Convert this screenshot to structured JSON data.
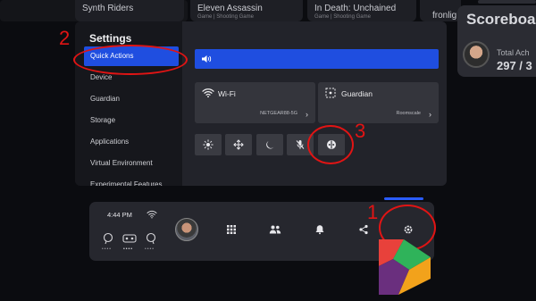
{
  "background": {
    "tiles": [
      {
        "title": "Synth Riders",
        "subtitle": ""
      },
      {
        "title": "Eleven Assassin",
        "subtitle": "Game | Shooting Game"
      },
      {
        "title": "In Death: Unchained",
        "subtitle": "Game | Shooting Game"
      },
      {
        "title": "fronlig",
        "subtitle": ""
      }
    ],
    "scoreboard": {
      "title": "Scoreboa",
      "label": "Total Ach",
      "value": "297 / 3"
    }
  },
  "settings": {
    "title": "Settings",
    "sidebar_items": [
      {
        "label": "Quick Actions",
        "active": true
      },
      {
        "label": "Device"
      },
      {
        "label": "Guardian"
      },
      {
        "label": "Storage"
      },
      {
        "label": "Applications"
      },
      {
        "label": "Virtual Environment"
      },
      {
        "label": "Experimental Features"
      }
    ],
    "volume_icon": "speaker-icon",
    "wifi_card": {
      "label": "Wi-Fi",
      "value": "NETGEAR88-5G",
      "icon": "wifi-icon"
    },
    "guardian_card": {
      "label": "Guardian",
      "value": "Roomscale",
      "icon": "guardian-icon"
    },
    "quick_buttons": [
      "brightness-icon",
      "move-icon",
      "night-mode-icon",
      "mic-off-icon",
      "passthrough-icon"
    ]
  },
  "dock": {
    "time": "4:44 PM",
    "left_status_dots": [
      "••••",
      "••••",
      "••••"
    ],
    "icons": [
      "apps-icon",
      "people-icon",
      "notifications-icon",
      "share-icon",
      "settings-icon"
    ]
  },
  "annotations": [
    {
      "number": "1"
    },
    {
      "number": "2"
    },
    {
      "number": "3"
    }
  ],
  "colors": {
    "accent": "#1f4ee0",
    "annotation": "#e11414"
  }
}
